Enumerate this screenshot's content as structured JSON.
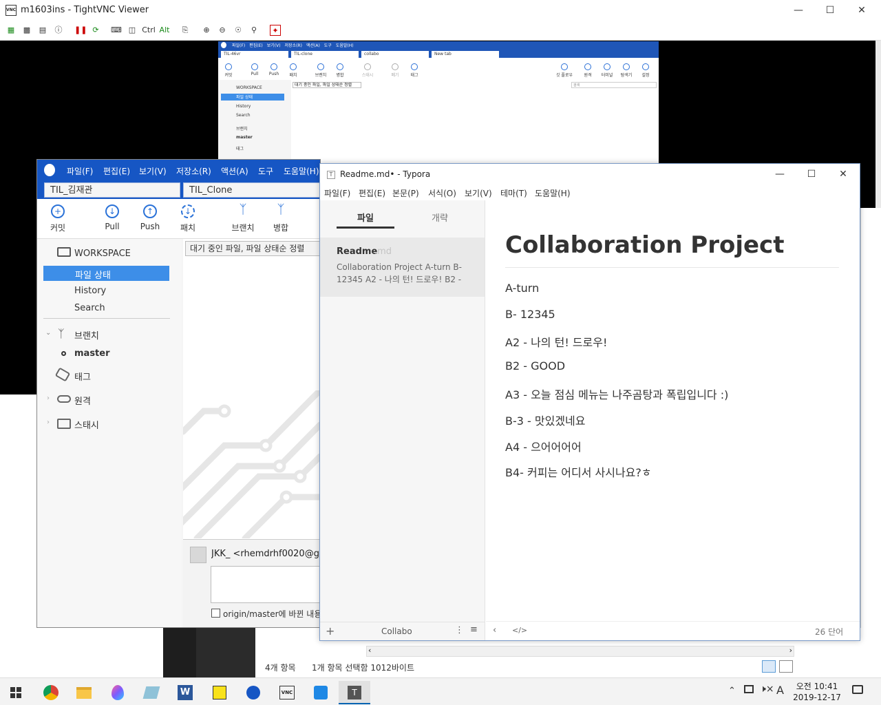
{
  "vnc": {
    "title": "m1603ins - TightVNC Viewer",
    "tool_ctrl": "Ctrl",
    "tool_alt": "Alt"
  },
  "remote_sourcetree": {
    "menu": [
      "파일(F)",
      "편집(E)",
      "보기(V)",
      "저장소(R)",
      "액션(A)",
      "도구",
      "도움말(H)"
    ],
    "tabs": [
      "TIL-46vr",
      "TIL-clone",
      "collabo",
      "New tab"
    ],
    "toolbar": [
      "커밋",
      "Pull",
      "Push",
      "패치",
      "브랜치",
      "병합",
      "스태시",
      "폐기",
      "태그"
    ],
    "toolbar_right": [
      "깃 플로우",
      "원격",
      "터미널",
      "탐색기",
      "설정"
    ],
    "sidebar": [
      "WORKSPACE",
      "파일 상태",
      "History",
      "Search",
      "브랜치",
      "master",
      "태그"
    ],
    "filter": "대기 중인 파일, 파일 상태순 정렬",
    "search_placeholder": "검색"
  },
  "sourcetree": {
    "menu": [
      "파일(F)",
      "편집(E)",
      "보기(V)",
      "저장소(R)",
      "액션(A)",
      "도구",
      "도움말(H)"
    ],
    "tabs": [
      "TIL_김재관",
      "TIL_Clone"
    ],
    "toolbar": [
      "커밋",
      "Pull",
      "Push",
      "패치",
      "브랜치",
      "병합"
    ],
    "workspace": "WORKSPACE",
    "file_status": "파일 상태",
    "history": "History",
    "search": "Search",
    "branch": "브랜치",
    "master": "master",
    "tag": "태그",
    "remote": "원격",
    "stash": "스태시",
    "filter": "대기 중인 파일, 파일 상태순 정렬",
    "author": "JKK_ <rhemdrhf0020@g",
    "push_option": "origin/master에 바뀐 내용"
  },
  "typora": {
    "title": "Readme.md• - Typora",
    "menu": [
      "파일(F)",
      "편집(E)",
      "본문(P)",
      "서식(O)",
      "보기(V)",
      "테마(T)",
      "도움말(H)"
    ],
    "side_tabs": [
      "파일",
      "개략"
    ],
    "file_name": "Readme",
    "file_ext": ".md",
    "file_preview": "Collaboration Project A-turn B-12345 A2 - 나의 턴! 드로우! B2 -",
    "folder": "Collabo",
    "heading": "Collaboration Project",
    "paragraphs": [
      "A-turn",
      "B- 12345",
      "A2 - 나의 턴! 드로우!",
      "B2 - GOOD",
      "A3 - 오늘 점심 메뉴는 나주곰탕과 폭립입니다 :)",
      "B-3 - 맛있겠네요",
      "A4 - 으어어어어",
      "B4- 커피는 어디서 사시나요?ㅎ"
    ],
    "word_count": "26 단어"
  },
  "explorer": {
    "items": "4개 항목",
    "selected": "1개 항목 선택함 1012바이트"
  },
  "taskbar": {
    "time": "오전 10:41",
    "date": "2019-12-17",
    "ime": "A"
  },
  "colors": {
    "sourcetree_blue": "#1656c4",
    "selection_blue": "#3d8ee8",
    "taskbar_accent": "#0063b1"
  }
}
